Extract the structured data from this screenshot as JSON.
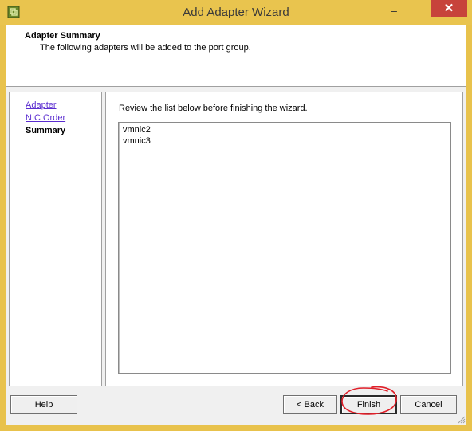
{
  "window": {
    "title": "Add Adapter Wizard",
    "minimize_label": "–",
    "close_label": "✕",
    "icon": "vsphere-app-icon",
    "frame_color": "#e9c44e",
    "close_color": "#c7433b"
  },
  "header": {
    "title": "Adapter Summary",
    "subtitle": "The following adapters will be added to the port group."
  },
  "nav": {
    "items": [
      {
        "label": "Adapter",
        "state": "link"
      },
      {
        "label": "NIC Order",
        "state": "link"
      },
      {
        "label": "Summary",
        "state": "current"
      }
    ],
    "link_color": "#5a2cd0"
  },
  "content": {
    "instruction": "Review the list below before finishing the wizard.",
    "adapters": [
      "vmnic2",
      "vmnic3"
    ]
  },
  "buttons": {
    "help": "Help",
    "back": "< Back",
    "finish": "Finish",
    "cancel": "Cancel"
  },
  "annotation": {
    "type": "hand-drawn-circle",
    "target": "finish-button",
    "color": "#e0202a"
  }
}
